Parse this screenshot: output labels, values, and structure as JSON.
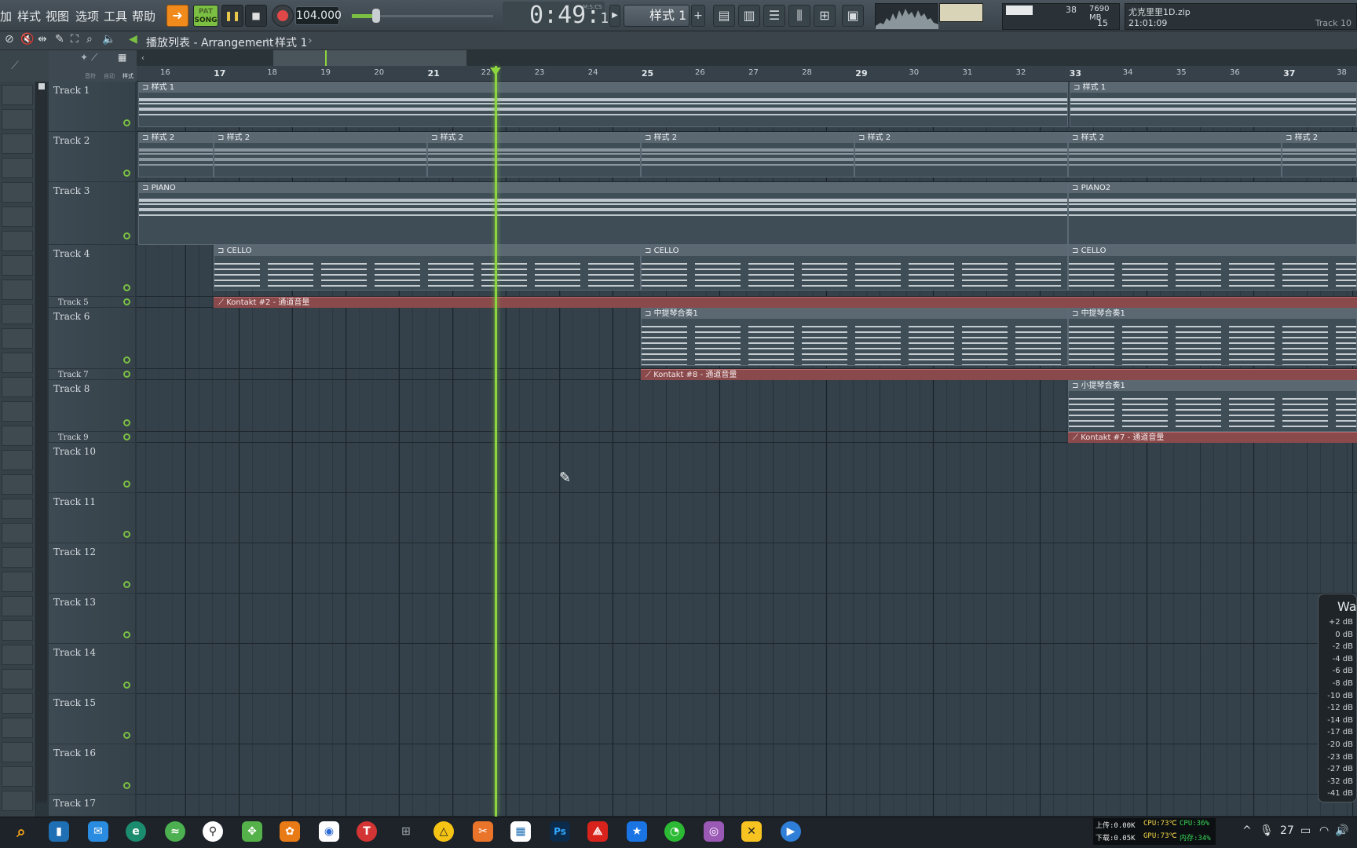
{
  "menu": [
    "加",
    "样式",
    "视图",
    "选项",
    "工具",
    "帮助"
  ],
  "transport": {
    "pat_label": "PAT",
    "song_label": "SONG",
    "tempo": "104.000"
  },
  "time": {
    "main": "0:49",
    "sub": "11",
    "unit": "M:S:CS"
  },
  "pattern_selector": {
    "value": "样式 1",
    "plus": "+"
  },
  "memory": {
    "cpu_value": "38",
    "mem": "7690 MB",
    "poly": "15"
  },
  "hint": {
    "file": "尤克里里1D.zip",
    "time": "21:01:09",
    "track": "Track 10"
  },
  "breadcrumb": {
    "title": "播放列表 - Arrangement",
    "sep": "›",
    "pattern": "样式 1",
    "end": "›"
  },
  "picker_tabs": [
    "音符",
    "自动",
    "样式"
  ],
  "ruler": [
    "16",
    "17",
    "18",
    "19",
    "20",
    "21",
    "22",
    "23",
    "24",
    "25",
    "26",
    "27",
    "28",
    "29",
    "30",
    "31",
    "32",
    "33",
    "34",
    "35",
    "36",
    "37",
    "38"
  ],
  "tracks": [
    {
      "name": "Track 1"
    },
    {
      "name": "Track 2"
    },
    {
      "name": "Track 3"
    },
    {
      "name": "Track 4"
    },
    {
      "name": "Track 5"
    },
    {
      "name": "Track 6"
    },
    {
      "name": "Track 7"
    },
    {
      "name": "Track 8"
    },
    {
      "name": "Track 9"
    },
    {
      "name": "Track 10"
    },
    {
      "name": "Track 11"
    },
    {
      "name": "Track 12"
    },
    {
      "name": "Track 13"
    },
    {
      "name": "Track 14"
    },
    {
      "name": "Track 15"
    },
    {
      "name": "Track 16"
    },
    {
      "name": "Track 17"
    }
  ],
  "clips": {
    "p1": "样式 1",
    "p2": "样式 2",
    "piano": "PIANO",
    "piano2": "PIANO2",
    "cello": "CELLO",
    "viola": "中提琴合奏1",
    "violin": "小提琴合奏1",
    "auto5": "Kontakt #2 - 通道音量",
    "auto7": "Kontakt #8 - 通道音量",
    "auto9": "Kontakt #7 - 通道音量"
  },
  "meter": {
    "title": "Wav",
    "levels": [
      "+2 dB",
      "0 dB",
      "-2 dB",
      "-4 dB",
      "-6 dB",
      "-8 dB",
      "-10 dB",
      "-12 dB",
      "-14 dB",
      "-17 dB",
      "-20 dB",
      "-23 dB",
      "-27 dB",
      "-32 dB",
      "-41 dB"
    ]
  },
  "taskbar": {
    "upload": "上传:0.00K",
    "download": "下载:0.05K",
    "cpu_temp": "CPU:73℃",
    "gpu_temp": "GPU:73℃",
    "cpu_use": "CPU:36%",
    "mem_use": "内存:34%",
    "clock": "27"
  }
}
